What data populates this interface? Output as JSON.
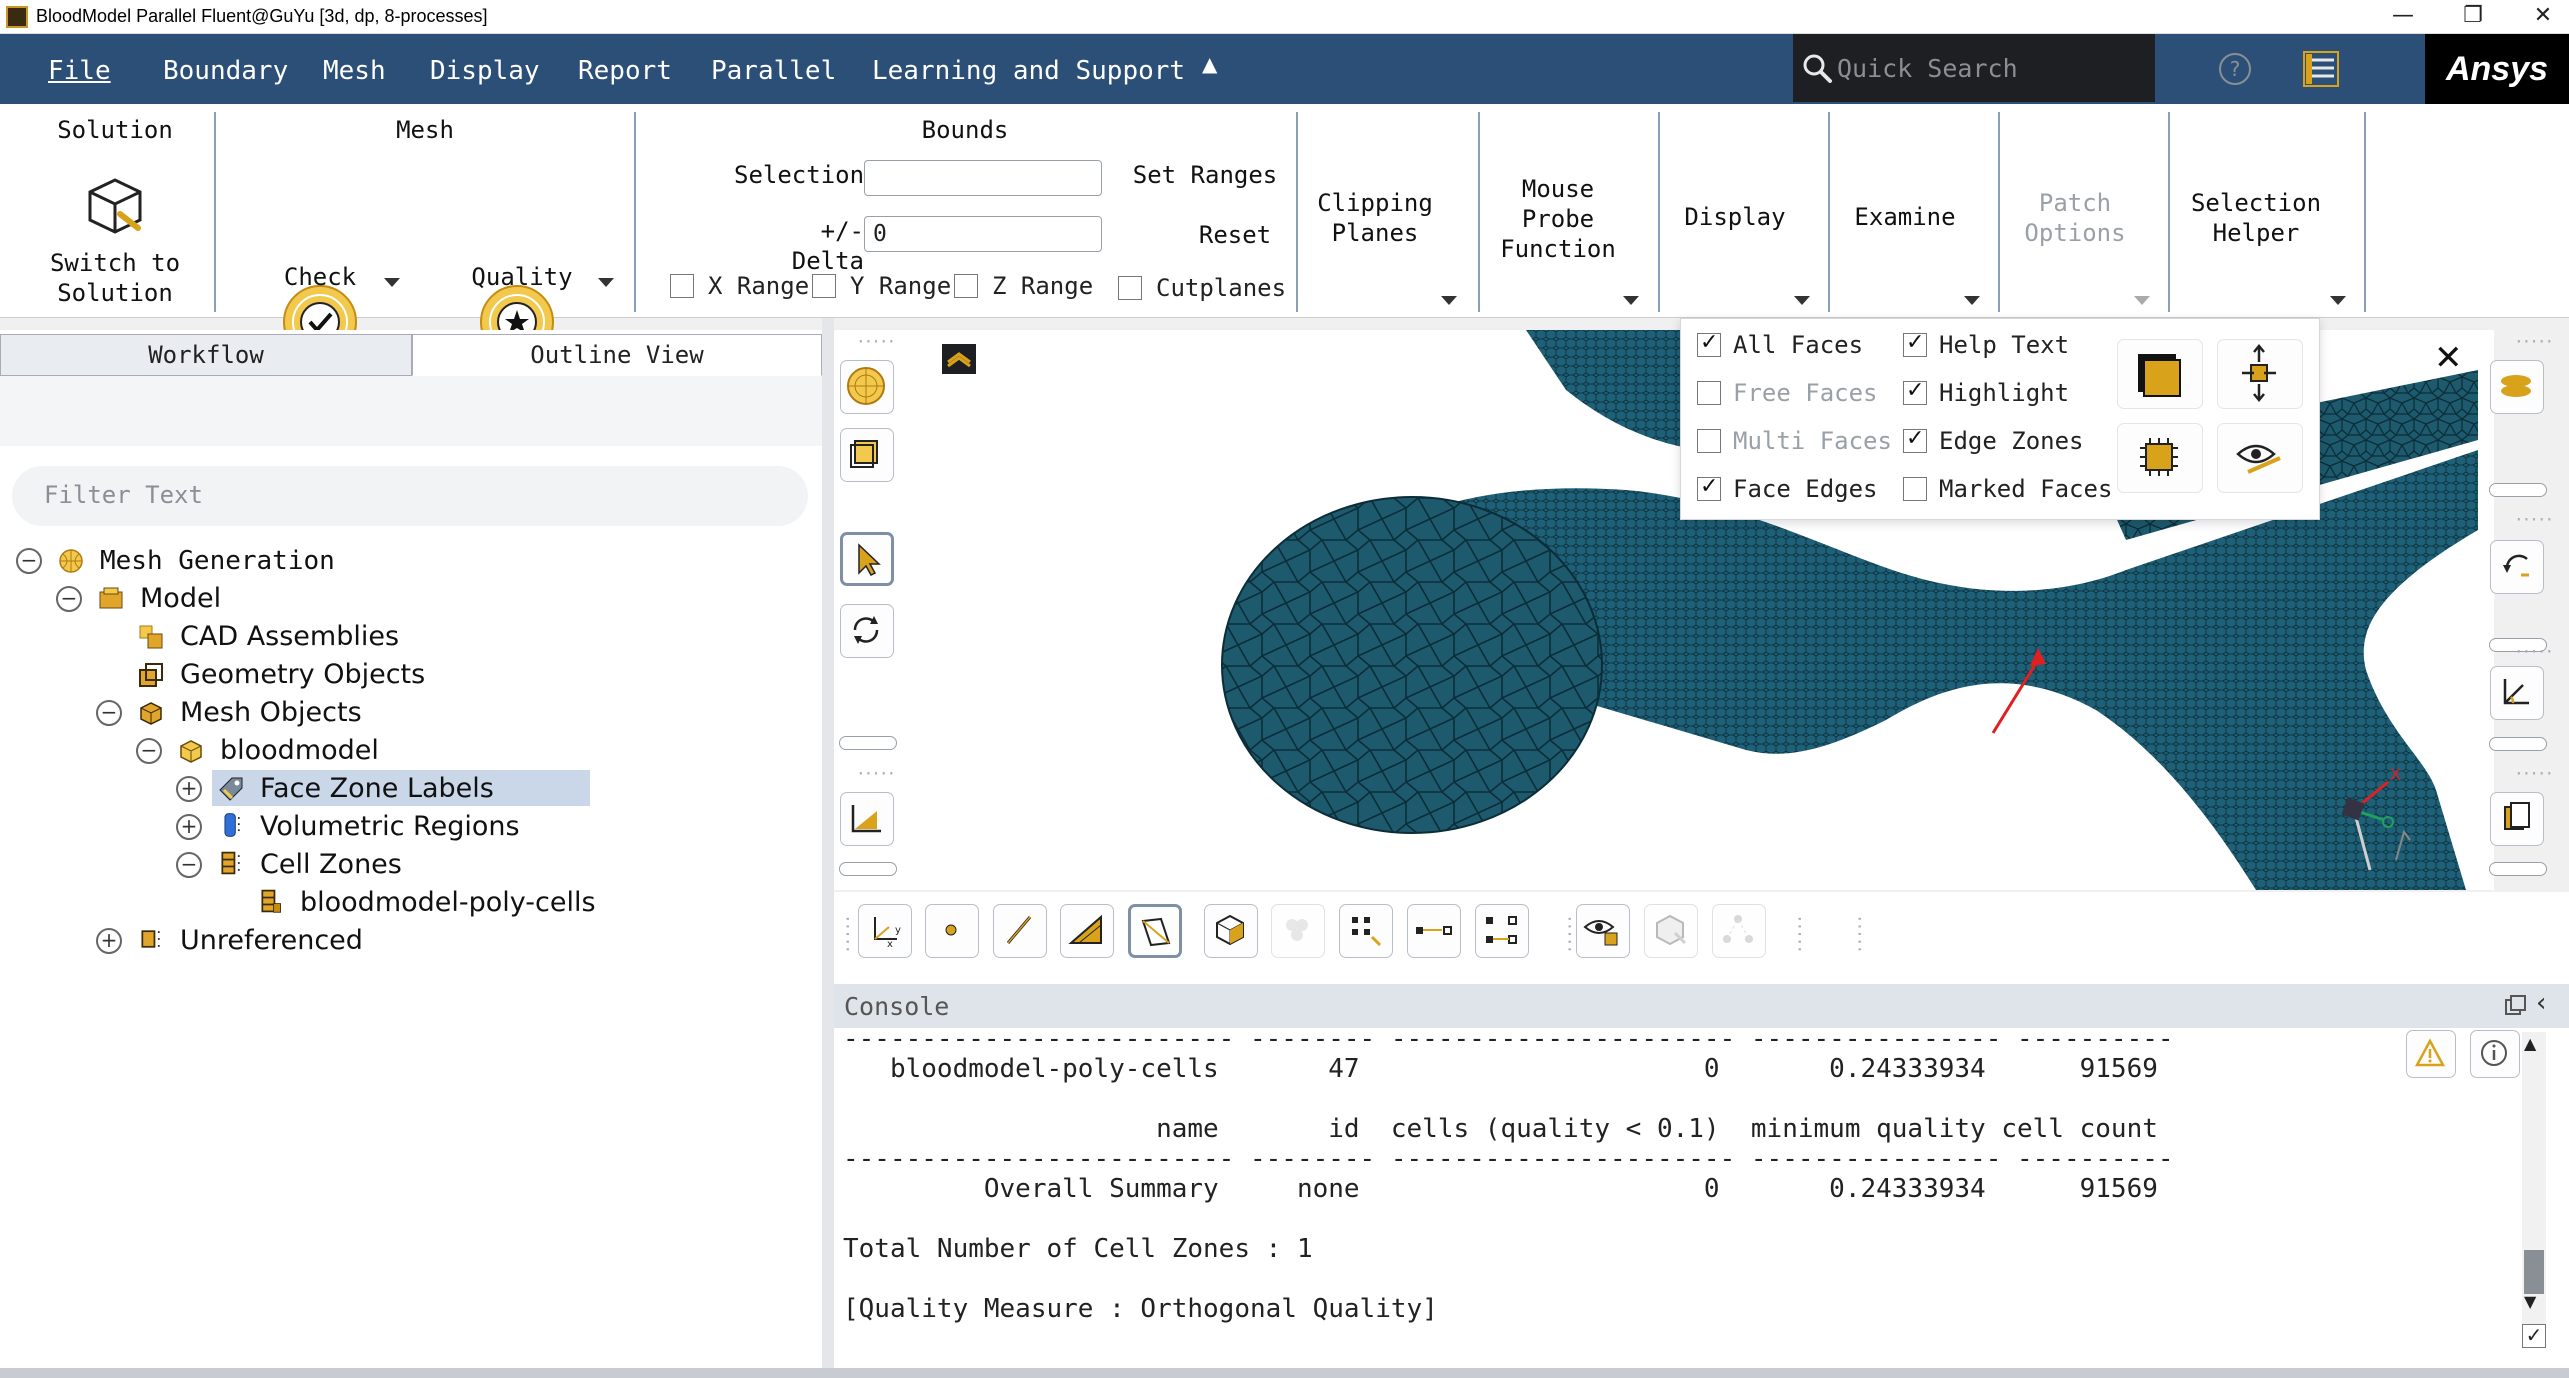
{
  "window": {
    "title": "BloodModel Parallel Fluent@GuYu  [3d, dp, 8-processes]",
    "minimize": "—",
    "restore": "❐",
    "close": "✕"
  },
  "menubar": {
    "items": [
      "File",
      "Boundary",
      "Mesh",
      "Display",
      "Report",
      "Parallel",
      "Learning and Support"
    ],
    "collapse": "▲",
    "search_placeholder": "Quick Search",
    "help": "?",
    "brand": "Ansys"
  },
  "ribbon": {
    "solution": {
      "title": "Solution",
      "button_line1": "Switch to",
      "button_line2": "Solution"
    },
    "mesh": {
      "title": "Mesh",
      "check": "Check",
      "quality": "Quality"
    },
    "bounds": {
      "title": "Bounds",
      "selection_label": "Selection",
      "selection_value": "",
      "delta_label": "+/- Delta",
      "delta_value": "0",
      "set_ranges": "Set Ranges",
      "reset": "Reset",
      "x_range": "X Range",
      "y_range": "Y Range",
      "z_range": "Z Range",
      "cutplanes": "Cutplanes"
    },
    "clipping": {
      "line1": "Clipping",
      "line2": "Planes"
    },
    "mouse_probe": {
      "line1": "Mouse",
      "line2": "Probe",
      "line3": "Function"
    },
    "display": "Display",
    "examine": "Examine",
    "patch": {
      "line1": "Patch",
      "line2": "Options"
    },
    "selection_helper": {
      "line1": "Selection",
      "line2": "Helper"
    }
  },
  "tabs": {
    "workflow": "Workflow",
    "outline": "Outline View"
  },
  "filter": {
    "placeholder": "Filter Text"
  },
  "tree": {
    "mesh_generation": "Mesh Generation",
    "model": "Model",
    "cad_assemblies": "CAD Assemblies",
    "geometry_objects": "Geometry Objects",
    "mesh_objects": "Mesh Objects",
    "bloodmodel": "bloodmodel",
    "face_zone_labels": "Face Zone Labels",
    "volumetric_regions": "Volumetric Regions",
    "cell_zones": "Cell Zones",
    "poly_cells": "bloodmodel-poly-cells",
    "unreferenced": "Unreferenced"
  },
  "display_options": {
    "all_faces": {
      "label": "All Faces",
      "checked": true
    },
    "free_faces": {
      "label": "Free Faces",
      "checked": false
    },
    "multi_faces": {
      "label": "Multi Faces",
      "checked": false
    },
    "face_edges": {
      "label": "Face Edges",
      "checked": true
    },
    "help_text": {
      "label": "Help Text",
      "checked": true
    },
    "highlight": {
      "label": "Highlight",
      "checked": true
    },
    "edge_zones": {
      "label": "Edge Zones",
      "checked": true
    },
    "marked_faces": {
      "label": "Marked Faces",
      "checked": false
    }
  },
  "colors": {
    "menubar": "#2b4f76",
    "mesh_fill": "#1d5a6e",
    "mesh_edge": "#0b2d38",
    "accent_gold": "#d9a21b"
  },
  "console": {
    "title": "Console",
    "lines": [
      "------------------------- -------- ---------------------- ---------------- ----------",
      "   bloodmodel-poly-cells       47                      0       0.24333934      91569",
      "",
      "                    name       id  cells (quality < 0.1)  minimum quality cell count",
      "------------------------- -------- ---------------------- ---------------- ----------",
      "         Overall Summary     none                      0       0.24333934      91569",
      "",
      "Total Number of Cell Zones : 1",
      "",
      "[Quality Measure : Orthogonal Quality]"
    ]
  }
}
